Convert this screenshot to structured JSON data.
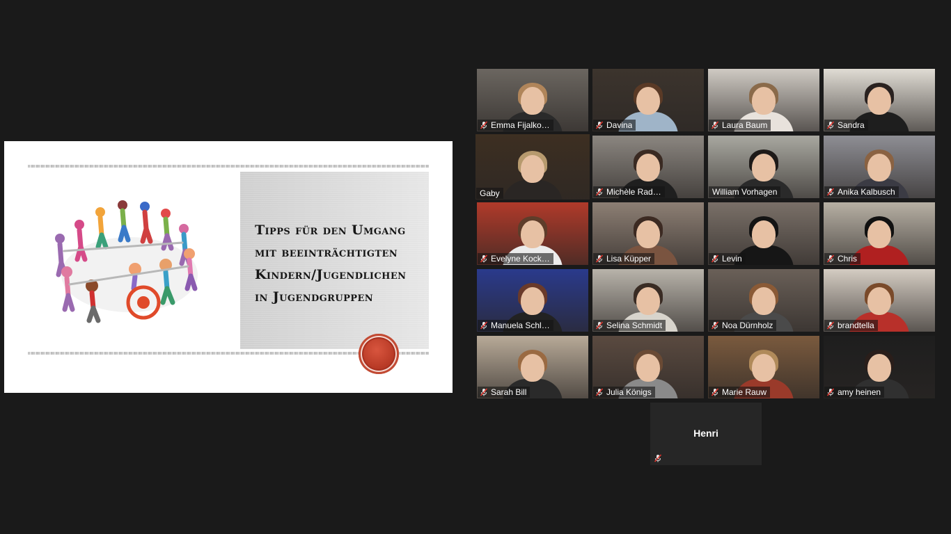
{
  "slide": {
    "title": "Tipps für den Umgang mit beeinträchtigten Kindern/Jugendlichen in Jugendgruppen"
  },
  "participants": [
    {
      "name": "Emma Fijalko…",
      "muted": true,
      "bg": "#6b6660",
      "hair": "#b0855a",
      "shirt": "#2a2a2a"
    },
    {
      "name": "Davina",
      "muted": true,
      "bg": "#3c342d",
      "hair": "#5a3a26",
      "shirt": "#9fb4c8"
    },
    {
      "name": "Laura Baum",
      "muted": true,
      "bg": "#cfcac3",
      "hair": "#8a6a4a",
      "shirt": "#e8e2dc"
    },
    {
      "name": "Sandra",
      "muted": true,
      "bg": "#e0dcd4",
      "hair": "#2a2220",
      "shirt": "#1e1e1e"
    },
    {
      "name": "Gaby",
      "muted": false,
      "speaking": true,
      "bg": "#3d2f22",
      "hair": "#b79a6e",
      "shirt": "#2a2624"
    },
    {
      "name": "Michèle Rad…",
      "muted": true,
      "bg": "#8b8680",
      "hair": "#3a2a22",
      "shirt": "#1f1f1f"
    },
    {
      "name": "William Vorhagen",
      "muted": false,
      "bg": "#a9a8a0",
      "hair": "#1e1a18",
      "shirt": "#2a2a2a"
    },
    {
      "name": "Anika Kalbusch",
      "muted": true,
      "bg": "#8e8e94",
      "hair": "#8a6242",
      "shirt": "#3b3b44"
    },
    {
      "name": "Evelyne Kock…",
      "muted": true,
      "bg": "#b03a2a",
      "hair": "#5e3d2a",
      "shirt": "#ececec"
    },
    {
      "name": "Lisa Küpper",
      "muted": true,
      "bg": "#8d7f74",
      "hair": "#3c2a22",
      "shirt": "#7a5440"
    },
    {
      "name": "Levin",
      "muted": true,
      "bg": "#7a7068",
      "hair": "#141414",
      "shirt": "#161616"
    },
    {
      "name": "Chris",
      "muted": true,
      "bg": "#b7b0a4",
      "hair": "#111111",
      "shirt": "#b02020"
    },
    {
      "name": "Manuela Schl…",
      "muted": true,
      "bg": "#2a3a8c",
      "hair": "#6a3a2a",
      "shirt": "#222222"
    },
    {
      "name": "Selina Schmidt",
      "muted": true,
      "bg": "#b8b3aa",
      "hair": "#3a2c24",
      "shirt": "#d8d4cc"
    },
    {
      "name": "Noa Dürnholz",
      "muted": true,
      "bg": "#6a6058",
      "hair": "#8a5a36",
      "shirt": "#4a4a4a"
    },
    {
      "name": "brandtella",
      "muted": true,
      "bg": "#d4ccc2",
      "hair": "#7a4a2a",
      "shirt": "#b8302a"
    },
    {
      "name": "Sarah Bill",
      "muted": true,
      "bg": "#b8aa98",
      "hair": "#9a6a42",
      "shirt": "#2a2a2a"
    },
    {
      "name": "Julia Königs",
      "muted": true,
      "bg": "#5a4a40",
      "hair": "#6a4a34",
      "shirt": "#8a8a8a"
    },
    {
      "name": "Marie Rauw",
      "muted": true,
      "bg": "#7a5a3e",
      "hair": "#b08a5a",
      "shirt": "#9a3a2a"
    },
    {
      "name": "amy heinen",
      "muted": true,
      "bg": "#1e1e1e",
      "hair": "#2a1e1a",
      "shirt": "#303030"
    }
  ],
  "audio_only": {
    "name": "Henri",
    "muted": true
  }
}
